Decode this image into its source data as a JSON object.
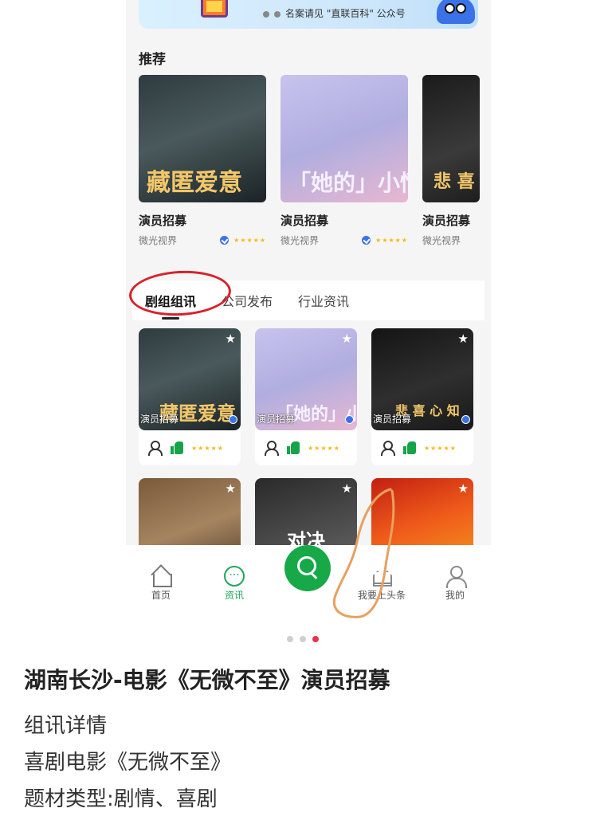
{
  "banner": {
    "text": "名案请见 \"直联百科\" 公众号"
  },
  "recommend": {
    "title": "推荐",
    "items": [
      {
        "title": "演员招募",
        "author": "微光视界",
        "poster": "藏匿爱意"
      },
      {
        "title": "演员招募",
        "author": "微光视界",
        "poster": "「她的」小情绪"
      },
      {
        "title": "演员招募",
        "author": "微光视界",
        "poster": "悲 喜"
      }
    ]
  },
  "tabs": [
    {
      "label": "剧组组讯",
      "active": true
    },
    {
      "label": "公司发布",
      "active": false
    },
    {
      "label": "行业资讯",
      "active": false
    }
  ],
  "grid": {
    "star": "★",
    "rating": "★★★★★",
    "items": [
      {
        "label": "演员招募",
        "poster": "藏匿爱意"
      },
      {
        "label": "演员招募",
        "poster": "「她的」小情"
      },
      {
        "label": "演员招募",
        "poster": "悲 喜   心 知"
      },
      {
        "label": "",
        "poster": ""
      },
      {
        "label": "",
        "poster": "对决"
      },
      {
        "label": "",
        "poster": ""
      }
    ]
  },
  "bottom_nav": [
    {
      "label": "首页",
      "icon": "home-icon",
      "active": false
    },
    {
      "label": "资讯",
      "icon": "chat-icon",
      "active": true
    },
    {
      "label": "我要上头条",
      "icon": "crown-icon",
      "active": false
    },
    {
      "label": "我的",
      "icon": "profile-icon",
      "active": false
    }
  ],
  "pagination": {
    "count": 3,
    "active_index": 2
  },
  "article": {
    "title": "湖南长沙-电影《无微不至》演员招募",
    "lines": [
      "组讯详情",
      "喜剧电影《无微不至》",
      "题材类型:剧情、喜剧"
    ]
  },
  "colors": {
    "accent_green": "#17a948",
    "annotation_red": "#d8212a",
    "annotation_orange": "#e8a060",
    "pagination_active": "#e8334a"
  }
}
